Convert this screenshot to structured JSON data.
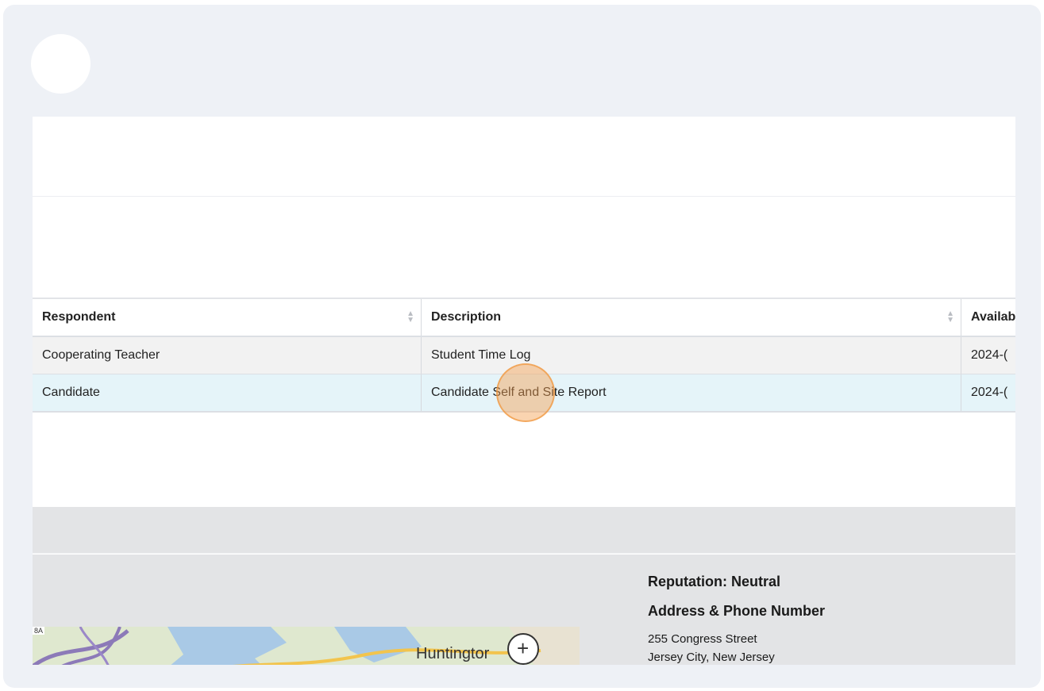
{
  "table": {
    "headers": [
      "Respondent",
      "Description",
      "Availab"
    ],
    "rows": [
      [
        "Cooperating Teacher",
        "Student Time Log",
        "2024-("
      ],
      [
        "Candidate",
        "Candidate Self and Site Report",
        "2024-("
      ]
    ]
  },
  "info": {
    "reputation": "Reputation: Neutral",
    "address_heading": "Address & Phone Number",
    "address_line1": "255 Congress Street",
    "address_line2": "Jersey City, New Jersey"
  },
  "map": {
    "label": "Huntingtor",
    "corner_label": "8A",
    "zoom_icon": "plus-icon"
  },
  "colors": {
    "frame": "#eef1f6",
    "highlight_row": "#e5f4f9",
    "click_marker": "#f3a050"
  }
}
